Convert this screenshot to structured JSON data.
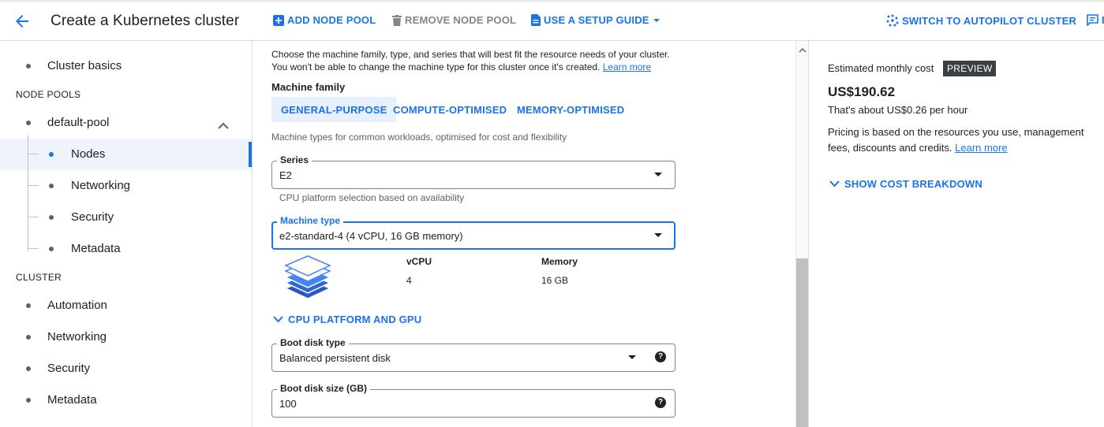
{
  "header": {
    "title": "Create a Kubernetes cluster",
    "add_node_pool": "ADD NODE POOL",
    "remove_node_pool": "REMOVE NODE POOL",
    "setup_guide": "USE A SETUP GUIDE",
    "switch_autopilot": "SWITCH TO AUTOPILOT CLUSTER",
    "cut_off_label": "I"
  },
  "sidebar": {
    "cluster_basics": "Cluster basics",
    "node_pools_heading": "NODE POOLS",
    "default_pool": "default-pool",
    "pool_items": [
      "Nodes",
      "Networking",
      "Security",
      "Metadata"
    ],
    "cluster_heading": "CLUSTER",
    "cluster_items": [
      "Automation",
      "Networking",
      "Security",
      "Metadata"
    ]
  },
  "main": {
    "description_line1": "Choose the machine family, type, and series that will best fit the resource needs of your cluster.",
    "description_line2": "You won't be able to change the machine type for this cluster once it's created.",
    "learn_more": "Learn more",
    "machine_family_label": "Machine family",
    "tabs": [
      "GENERAL-PURPOSE",
      "COMPUTE-OPTIMISED",
      "MEMORY-OPTIMISED"
    ],
    "family_hint": "Machine types for common workloads, optimised for cost and flexibility",
    "series": {
      "label": "Series",
      "value": "E2",
      "hint": "CPU platform selection based on availability"
    },
    "machine_type": {
      "label": "Machine type",
      "value": "e2-standard-4 (4 vCPU, 16 GB memory)"
    },
    "specs": {
      "vcpu_label": "vCPU",
      "vcpu_value": "4",
      "memory_label": "Memory",
      "memory_value": "16 GB"
    },
    "cpu_platform_gpu": "CPU PLATFORM AND GPU",
    "boot_disk_type": {
      "label": "Boot disk type",
      "value": "Balanced persistent disk"
    },
    "boot_disk_size": {
      "label": "Boot disk size (GB)",
      "value": "100"
    }
  },
  "cost_panel": {
    "label": "Estimated monthly cost",
    "badge": "PREVIEW",
    "amount": "US$190.62",
    "per_hour": "That's about US$0.26 per hour",
    "note": "Pricing is based on the resources you use, management fees, discounts and credits.",
    "learn_more": "Learn more",
    "breakdown": "SHOW COST BREAKDOWN"
  },
  "colors": {
    "accent": "#1a73e8",
    "text": "#202124",
    "muted": "#5f6368",
    "selected_bg": "#e8f0fe"
  },
  "icons": [
    "arrow-back-icon",
    "add-box-icon",
    "delete-icon",
    "document-icon",
    "dropdown-caret-icon",
    "autopilot-icon",
    "feedback-icon",
    "expand-less-icon",
    "expand-more-icon",
    "help-icon",
    "layers-icon"
  ]
}
